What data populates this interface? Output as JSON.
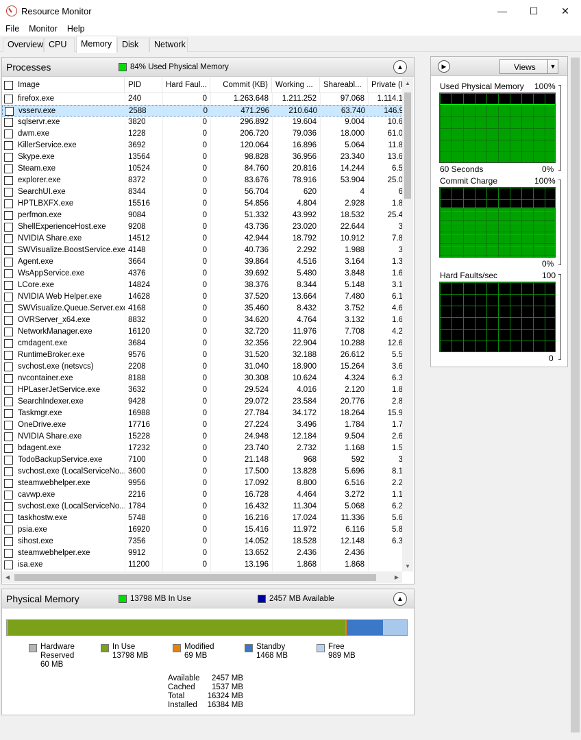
{
  "window": {
    "title": "Resource Monitor",
    "minimize": "—",
    "maximize": "☐",
    "close": "✕"
  },
  "menu": [
    "File",
    "Monitor",
    "Help"
  ],
  "tabs": [
    "Overview",
    "CPU",
    "Memory",
    "Disk",
    "Network"
  ],
  "active_tab": "Memory",
  "processes": {
    "title": "Processes",
    "summary": "84% Used Physical Memory",
    "summary_color": "#00e000",
    "columns": [
      "Image",
      "PID",
      "Hard Faul...",
      "Commit (KB)",
      "Working ...",
      "Shareabl...",
      "Private (K"
    ],
    "selected_row": 1,
    "rows": [
      [
        "firefox.exe",
        "240",
        "0",
        "1.263.648",
        "1.211.252",
        "97.068",
        "1.114.1"
      ],
      [
        "vsserv.exe",
        "2588",
        "0",
        "471.296",
        "210.640",
        "63.740",
        "146.9"
      ],
      [
        "sqlservr.exe",
        "3820",
        "0",
        "296.892",
        "19.604",
        "9.004",
        "10.6"
      ],
      [
        "dwm.exe",
        "1228",
        "0",
        "206.720",
        "79.036",
        "18.000",
        "61.0"
      ],
      [
        "KillerService.exe",
        "3692",
        "0",
        "120.064",
        "16.896",
        "5.064",
        "11.8"
      ],
      [
        "Skype.exe",
        "13564",
        "0",
        "98.828",
        "36.956",
        "23.340",
        "13.6"
      ],
      [
        "Steam.exe",
        "10524",
        "0",
        "84.760",
        "20.816",
        "14.244",
        "6.5"
      ],
      [
        "explorer.exe",
        "8372",
        "0",
        "83.676",
        "78.916",
        "53.904",
        "25.0"
      ],
      [
        "SearchUI.exe",
        "8344",
        "0",
        "56.704",
        "620",
        "4",
        "6"
      ],
      [
        "HPTLBXFX.exe",
        "15516",
        "0",
        "54.856",
        "4.804",
        "2.928",
        "1.8"
      ],
      [
        "perfmon.exe",
        "9084",
        "0",
        "51.332",
        "43.992",
        "18.532",
        "25.4"
      ],
      [
        "ShellExperienceHost.exe",
        "9208",
        "0",
        "43.736",
        "23.020",
        "22.644",
        "3"
      ],
      [
        "NVIDIA Share.exe",
        "14512",
        "0",
        "42.944",
        "18.792",
        "10.912",
        "7.8"
      ],
      [
        "SWVisualize.BoostService.exe",
        "4148",
        "0",
        "40.736",
        "2.292",
        "1.988",
        "3"
      ],
      [
        "Agent.exe",
        "3664",
        "0",
        "39.864",
        "4.516",
        "3.164",
        "1.3"
      ],
      [
        "WsAppService.exe",
        "4376",
        "0",
        "39.692",
        "5.480",
        "3.848",
        "1.6"
      ],
      [
        "LCore.exe",
        "14824",
        "0",
        "38.376",
        "8.344",
        "5.148",
        "3.1"
      ],
      [
        "NVIDIA Web Helper.exe",
        "14628",
        "0",
        "37.520",
        "13.664",
        "7.480",
        "6.1"
      ],
      [
        "SWVisualize.Queue.Server.exe",
        "4168",
        "0",
        "35.460",
        "8.432",
        "3.752",
        "4.6"
      ],
      [
        "OVRServer_x64.exe",
        "8832",
        "0",
        "34.620",
        "4.764",
        "3.132",
        "1.6"
      ],
      [
        "NetworkManager.exe",
        "16120",
        "0",
        "32.720",
        "11.976",
        "7.708",
        "4.2"
      ],
      [
        "cmdagent.exe",
        "3684",
        "0",
        "32.356",
        "22.904",
        "10.288",
        "12.6"
      ],
      [
        "RuntimeBroker.exe",
        "9576",
        "0",
        "31.520",
        "32.188",
        "26.612",
        "5.5"
      ],
      [
        "svchost.exe (netsvcs)",
        "2208",
        "0",
        "31.040",
        "18.900",
        "15.264",
        "3.6"
      ],
      [
        "nvcontainer.exe",
        "8188",
        "0",
        "30.308",
        "10.624",
        "4.324",
        "6.3"
      ],
      [
        "HPLaserJetService.exe",
        "3632",
        "0",
        "29.524",
        "4.016",
        "2.120",
        "1.8"
      ],
      [
        "SearchIndexer.exe",
        "9428",
        "0",
        "29.072",
        "23.584",
        "20.776",
        "2.8"
      ],
      [
        "Taskmgr.exe",
        "16988",
        "0",
        "27.784",
        "34.172",
        "18.264",
        "15.9"
      ],
      [
        "OneDrive.exe",
        "17716",
        "0",
        "27.224",
        "3.496",
        "1.784",
        "1.7"
      ],
      [
        "NVIDIA Share.exe",
        "15228",
        "0",
        "24.948",
        "12.184",
        "9.504",
        "2.6"
      ],
      [
        "bdagent.exe",
        "17232",
        "0",
        "23.740",
        "2.732",
        "1.168",
        "1.5"
      ],
      [
        "TodoBackupService.exe",
        "7100",
        "0",
        "21.148",
        "968",
        "592",
        "3"
      ],
      [
        "svchost.exe (LocalServiceNo...",
        "3600",
        "0",
        "17.500",
        "13.828",
        "5.696",
        "8.1"
      ],
      [
        "steamwebhelper.exe",
        "9956",
        "0",
        "17.092",
        "8.800",
        "6.516",
        "2.2"
      ],
      [
        "cavwp.exe",
        "2216",
        "0",
        "16.728",
        "4.464",
        "3.272",
        "1.1"
      ],
      [
        "svchost.exe (LocalServiceNo...",
        "1784",
        "0",
        "16.432",
        "11.304",
        "5.068",
        "6.2"
      ],
      [
        "taskhostw.exe",
        "5748",
        "0",
        "16.216",
        "17.024",
        "11.336",
        "5.6"
      ],
      [
        "psia.exe",
        "16920",
        "0",
        "15.416",
        "11.972",
        "6.116",
        "5.8"
      ],
      [
        "sihost.exe",
        "7356",
        "0",
        "14.052",
        "18.528",
        "12.148",
        "6.3"
      ],
      [
        "steamwebhelper.exe",
        "9912",
        "0",
        "13.652",
        "2.436",
        "2.436",
        ""
      ],
      [
        "isa.exe",
        "11200",
        "0",
        "13.196",
        "1.868",
        "1.868",
        ""
      ]
    ]
  },
  "physical_memory": {
    "title": "Physical Memory",
    "in_use_label": "13798 MB In Use",
    "available_label": "2457 MB Available",
    "in_use_color": "#00e000",
    "available_color": "#0000a0",
    "bar": [
      {
        "name": "Hardware Reserved",
        "mb": 60,
        "color": "#a6a6a6"
      },
      {
        "name": "In Use",
        "mb": 13798,
        "color": "#7ba11a"
      },
      {
        "name": "Modified",
        "mb": 69,
        "color": "#e8820c"
      },
      {
        "name": "Standby",
        "mb": 1468,
        "color": "#3b78c8"
      },
      {
        "name": "Free",
        "mb": 989,
        "color": "#a8c8ec"
      }
    ],
    "legend": [
      {
        "line1": "Hardware",
        "line2": "Reserved",
        "line3": "60 MB",
        "color": "#b4b4b4"
      },
      {
        "line1": "In Use",
        "line2": "13798 MB",
        "line3": "",
        "color": "#7ba11a"
      },
      {
        "line1": "Modified",
        "line2": "69 MB",
        "line3": "",
        "color": "#e8820c"
      },
      {
        "line1": "Standby",
        "line2": "1468 MB",
        "line3": "",
        "color": "#3b78c8"
      },
      {
        "line1": "Free",
        "line2": "989 MB",
        "line3": "",
        "color": "#b8d3f0"
      }
    ],
    "stats": [
      {
        "k": "Available",
        "v": "2457 MB"
      },
      {
        "k": "Cached",
        "v": "1537 MB"
      },
      {
        "k": "Total",
        "v": "16324 MB"
      },
      {
        "k": "Installed",
        "v": "16384 MB"
      }
    ]
  },
  "right_pane": {
    "views_label": "Views",
    "graphs": [
      {
        "title": "Used Physical Memory",
        "max": "100%",
        "bottom_left": "60 Seconds",
        "min": "0%",
        "fill_percent": 84
      },
      {
        "title": "Commit Charge",
        "max": "100%",
        "bottom_left": "",
        "min": "0%",
        "fill_percent": 71
      },
      {
        "title": "Hard Faults/sec",
        "max": "100",
        "bottom_left": "",
        "min": "0",
        "fill_percent": 0
      }
    ]
  }
}
